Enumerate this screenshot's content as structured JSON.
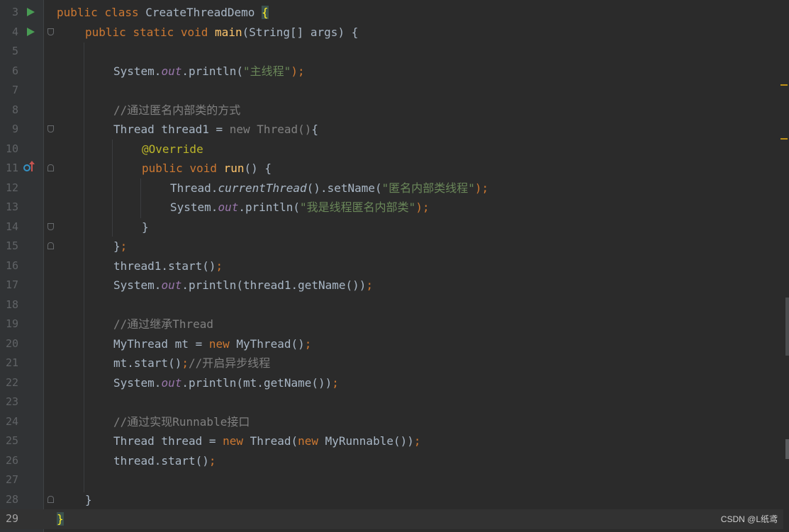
{
  "editor": {
    "lines": [
      {
        "n": "3"
      },
      {
        "n": "4"
      },
      {
        "n": "5"
      },
      {
        "n": "6"
      },
      {
        "n": "7"
      },
      {
        "n": "8"
      },
      {
        "n": "9"
      },
      {
        "n": "10"
      },
      {
        "n": "11"
      },
      {
        "n": "12"
      },
      {
        "n": "13"
      },
      {
        "n": "14"
      },
      {
        "n": "15"
      },
      {
        "n": "16"
      },
      {
        "n": "17"
      },
      {
        "n": "18"
      },
      {
        "n": "19"
      },
      {
        "n": "20"
      },
      {
        "n": "21"
      },
      {
        "n": "22"
      },
      {
        "n": "23"
      },
      {
        "n": "24"
      },
      {
        "n": "25"
      },
      {
        "n": "26"
      },
      {
        "n": "27"
      },
      {
        "n": "28"
      },
      {
        "n": "29"
      }
    ],
    "current_line": "29",
    "code": {
      "l3": {
        "kw1": "public",
        "kw2": "class",
        "name": "CreateThreadDemo",
        "brace": "{"
      },
      "l4": {
        "kw1": "public",
        "kw2": "static",
        "kw3": "void",
        "fn": "main",
        "rest": "(String[] args) {"
      },
      "l6": {
        "pre": "System.",
        "field": "out",
        "mid": ".println(",
        "str": "\"主线程\"",
        "end": ");"
      },
      "l8": {
        "comment": "//通过匿名内部类的方式"
      },
      "l9": {
        "pre": "Thread thread1 = ",
        "gray": "new Thread()",
        "end": "{"
      },
      "l10": {
        "ann": "@Override"
      },
      "l11": {
        "kw1": "public",
        "kw2": "void",
        "fn": "run",
        "rest": "() {"
      },
      "l12": {
        "pre": "Thread.",
        "ital": "currentThread",
        "mid": "().setName(",
        "str": "\"匿名内部类线程\"",
        "end": ");"
      },
      "l13": {
        "pre": "System.",
        "field": "out",
        "mid": ".println(",
        "str": "\"我是线程匿名内部类\"",
        "end": ");"
      },
      "l14": {
        "text": "}"
      },
      "l15": {
        "text": "}",
        "semi": ";"
      },
      "l16": {
        "text": "thread1.start()",
        "semi": ";"
      },
      "l17": {
        "pre": "System.",
        "field": "out",
        "mid": ".println(thread1.getName())",
        "semi": ";"
      },
      "l19": {
        "comment": "//通过继承Thread"
      },
      "l20": {
        "pre": "MyThread mt = ",
        "kw": "new",
        "mid": " MyThread()",
        "semi": ";"
      },
      "l21": {
        "text": "mt.start()",
        "semi": ";",
        "comment": "//开启异步线程"
      },
      "l22": {
        "pre": "System.",
        "field": "out",
        "mid": ".println(mt.getName())",
        "semi": ";"
      },
      "l24": {
        "comment": "//通过实现Runnable接口"
      },
      "l25": {
        "pre": "Thread thread = ",
        "kw1": "new",
        "mid1": " Thread(",
        "kw2": "new",
        "mid2": " MyRunnable())",
        "semi": ";"
      },
      "l26": {
        "text": "thread.start()",
        "semi": ";"
      },
      "l28": {
        "text": "}"
      },
      "l29": {
        "text": "}"
      }
    }
  },
  "watermark": "CSDN @L纸鸢",
  "colors": {
    "keyword": "#cc7832",
    "string": "#6a8759",
    "comment": "#808080",
    "function": "#ffc66d",
    "annotation": "#bbb529",
    "field": "#9876aa",
    "text": "#a9b7c6",
    "background": "#2b2b2b"
  }
}
